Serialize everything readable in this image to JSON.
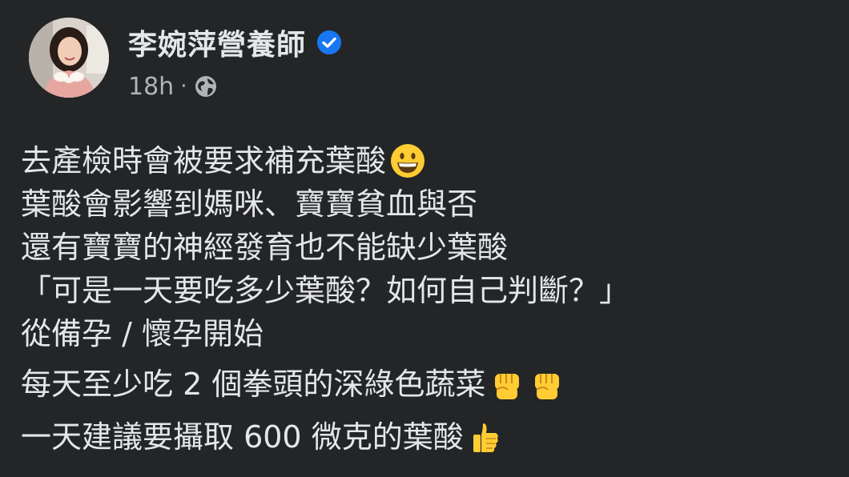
{
  "author": {
    "name": "李婉萍營養師",
    "verified": true,
    "avatar_alt": "author-avatar"
  },
  "post_meta": {
    "time": "18h",
    "separator": "·",
    "audience_icon": "globe-icon"
  },
  "content": {
    "lines": [
      {
        "text": "去產檢時會被要求補充葉酸",
        "emoji": [
          "grinning-face-emoji"
        ]
      },
      {
        "text": "葉酸會影響到媽咪、寶寶貧血與否",
        "emoji": []
      },
      {
        "text": "還有寶寶的神經發育也不能缺少葉酸",
        "emoji": []
      },
      {
        "text": "「可是一天要吃多少葉酸？如何自己判斷？」",
        "emoji": []
      },
      {
        "text": "從備孕 / 懷孕開始",
        "emoji": []
      },
      {
        "text": "每天至少吃 2 個拳頭的深綠色蔬菜",
        "emoji": [
          "raised-fist-emoji",
          "raised-fist-emoji"
        ]
      },
      {
        "text": "一天建議要攝取 600 微克的葉酸",
        "emoji": [
          "thumbs-up-emoji"
        ]
      }
    ]
  },
  "colors": {
    "background": "#242526",
    "text_primary": "#e4e6eb",
    "text_secondary": "#b0b3b8",
    "verified_blue": "#1877f2",
    "emoji_yellow": "#ffcc33"
  }
}
